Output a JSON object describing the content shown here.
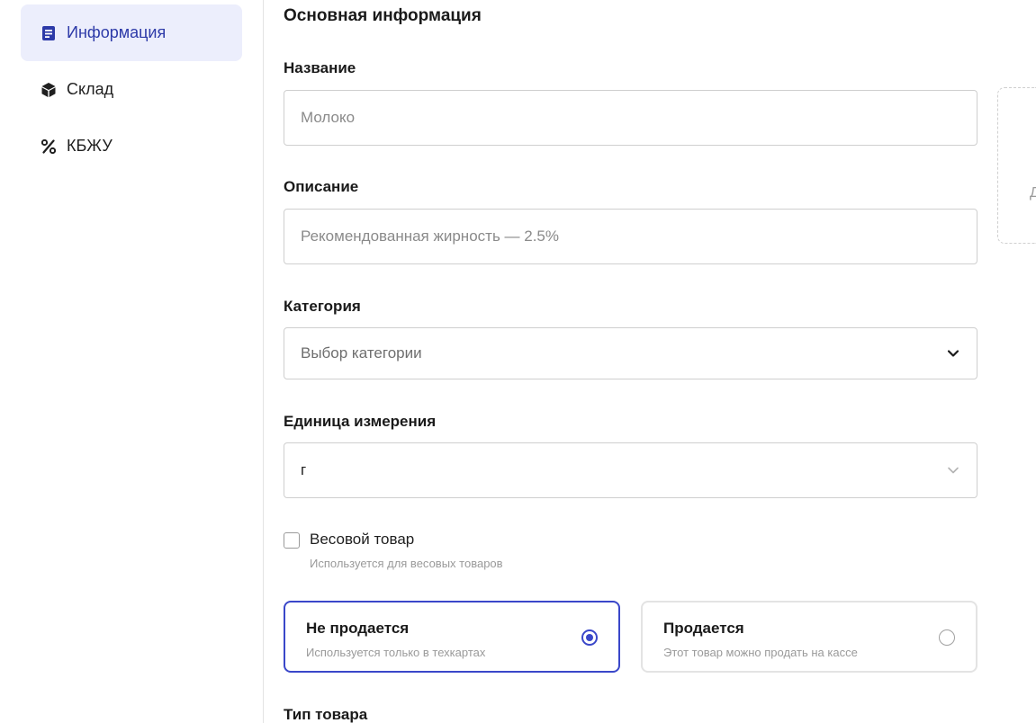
{
  "sidebar": {
    "items": [
      {
        "label": "Информация",
        "icon": "document-icon",
        "active": true
      },
      {
        "label": "Склад",
        "icon": "box-icon",
        "active": false
      },
      {
        "label": "КБЖУ",
        "icon": "percent-icon",
        "active": false
      }
    ]
  },
  "form": {
    "section_title": "Основная информация",
    "name": {
      "label": "Название",
      "placeholder": "Молоко",
      "value": ""
    },
    "description": {
      "label": "Описание",
      "placeholder": "Рекомендованная жирность — 2.5%",
      "value": ""
    },
    "category": {
      "label": "Категория",
      "placeholder": "Выбор категории"
    },
    "unit": {
      "label": "Единица измерения",
      "value": "г"
    },
    "weight_item": {
      "label": "Весовой товар",
      "hint": "Используется для весовых товаров",
      "checked": false
    },
    "sale_options": [
      {
        "title": "Не продается",
        "subtitle": "Используется только в техкартах",
        "selected": true
      },
      {
        "title": "Продается",
        "subtitle": "Этот товар можно продать на кассе",
        "selected": false
      }
    ],
    "product_type_label": "Тип товара"
  },
  "dropzone": {
    "visible_glyph": "Д"
  },
  "colors": {
    "accent": "#3a47c9",
    "active_bg": "#eceefc",
    "border": "#cfcfcf",
    "muted_text": "#9a9a9a"
  }
}
